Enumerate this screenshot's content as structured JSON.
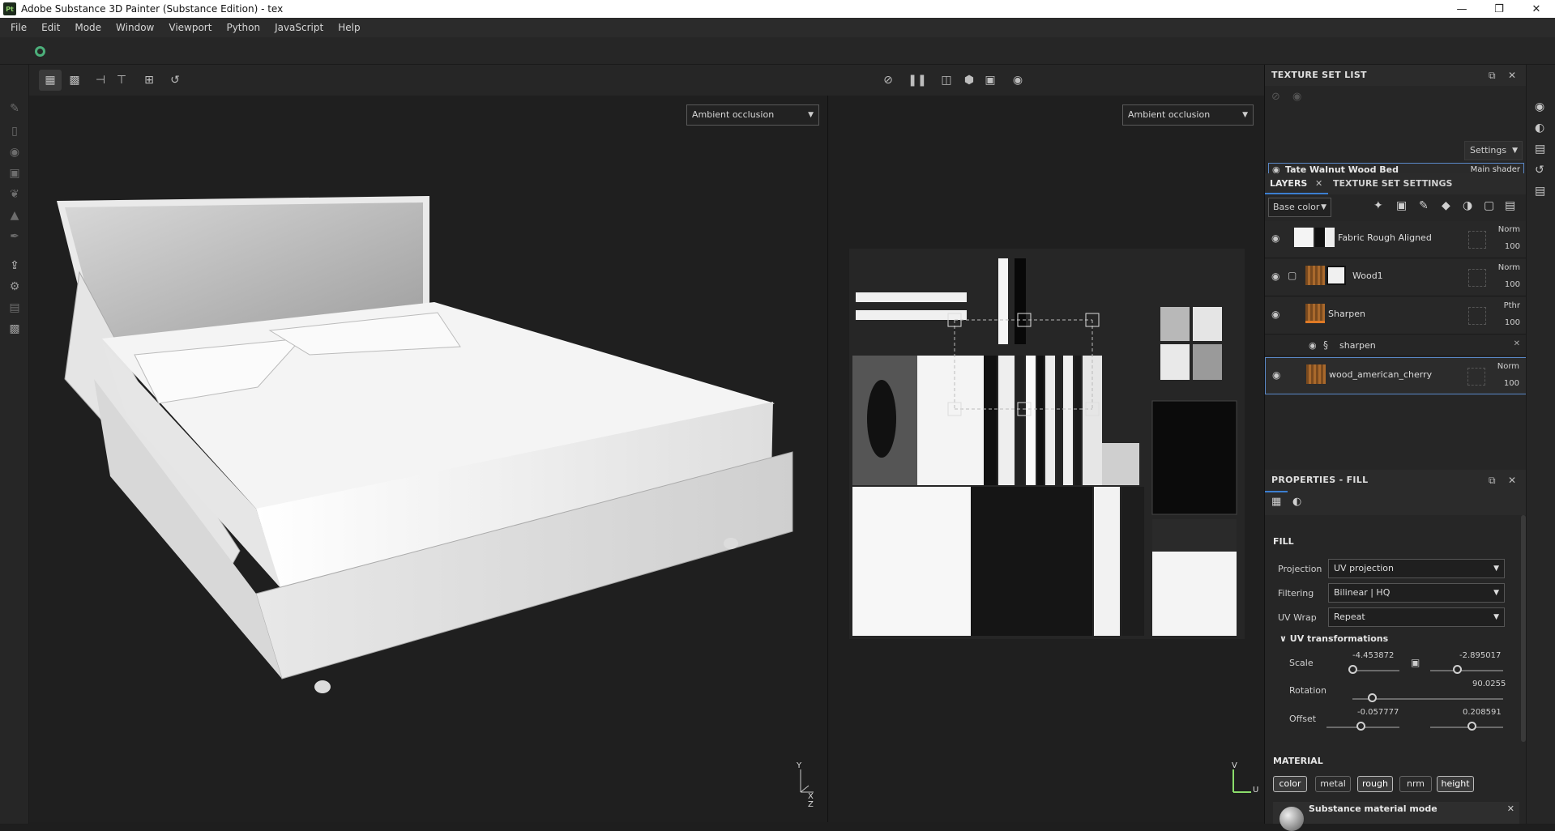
{
  "window": {
    "title": "Adobe Substance 3D Painter (Substance Edition) - tex",
    "logo_text": "Pt",
    "controls": [
      "minimize-icon",
      "restore-icon",
      "close-icon"
    ]
  },
  "menu": [
    "File",
    "Edit",
    "Mode",
    "Window",
    "Viewport",
    "Python",
    "JavaScript",
    "Help"
  ],
  "viewport3d": {
    "channel_dropdown": "Ambient occlusion",
    "axis_y": "Y",
    "axis_z": "Z",
    "axis_x": "X"
  },
  "viewport2d": {
    "channel_dropdown": "Ambient occlusion",
    "axis_v": "V",
    "axis_u": "U"
  },
  "texture_set_list": {
    "header": "TEXTURE SET LIST",
    "settings_label": "Settings",
    "items": [
      {
        "name": "Tate Walnut Wood Bed",
        "shader": "Main shader"
      }
    ]
  },
  "layers": {
    "tab_layers": "LAYERS",
    "tab_texture_settings": "TEXTURE SET SETTINGS",
    "channel_select": "Base color",
    "items": [
      {
        "name": "Fabric Rough Aligned",
        "blend": "Norm",
        "opacity": "100"
      },
      {
        "name": "Wood1",
        "blend": "Norm",
        "opacity": "100"
      },
      {
        "name": "Sharpen",
        "blend": "Pthr",
        "opacity": "100"
      },
      {
        "name": "sharpen",
        "sub": true
      },
      {
        "name": "wood_american_cherry",
        "blend": "Norm",
        "opacity": "100"
      }
    ]
  },
  "properties": {
    "header": "PROPERTIES - FILL",
    "section_fill": "FILL",
    "projection_label": "Projection",
    "projection_value": "UV projection",
    "filtering_label": "Filtering",
    "filtering_value": "Bilinear | HQ",
    "uvwrap_label": "UV Wrap",
    "uvwrap_value": "Repeat",
    "uv_transformations": "UV transformations",
    "scale_label": "Scale",
    "scale_u": "-4.453872",
    "scale_v": "-2.895017",
    "rotation_label": "Rotation",
    "rotation_value": "90.0255",
    "offset_label": "Offset",
    "offset_u": "-0.057777",
    "offset_v": "0.208591",
    "section_material": "MATERIAL",
    "material_buttons": [
      {
        "label": "color",
        "on": true
      },
      {
        "label": "metal",
        "on": false
      },
      {
        "label": "rough",
        "on": true
      },
      {
        "label": "nrm",
        "on": false
      },
      {
        "label": "height",
        "on": true
      }
    ],
    "substance_mode": "Substance material mode"
  }
}
